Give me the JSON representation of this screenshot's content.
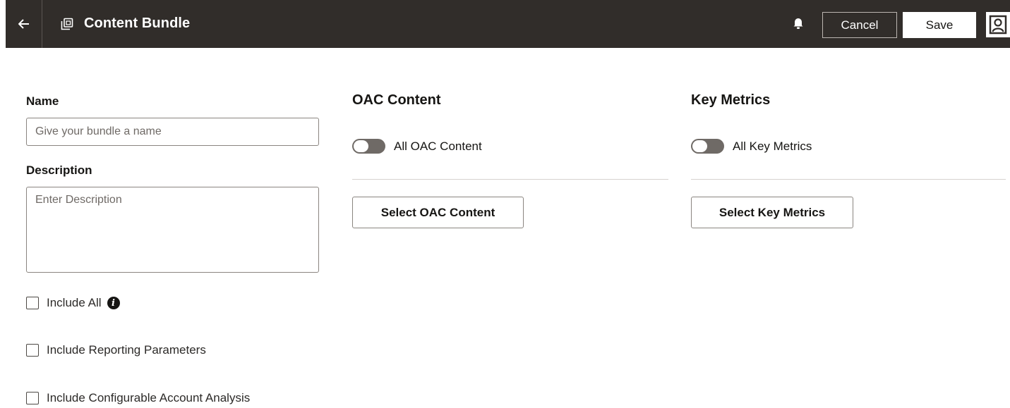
{
  "header": {
    "title": "Content Bundle",
    "cancel_label": "Cancel",
    "save_label": "Save"
  },
  "form": {
    "name_label": "Name",
    "name_placeholder": "Give your bundle a name",
    "name_value": "",
    "description_label": "Description",
    "description_placeholder": "Enter Description",
    "description_value": "",
    "checkboxes": [
      {
        "label": "Include All",
        "checked": false
      },
      {
        "label": "Include Reporting Parameters",
        "checked": false
      },
      {
        "label": "Include Configurable Account Analysis",
        "checked": false
      }
    ]
  },
  "oac": {
    "title": "OAC Content",
    "toggle_label": "All OAC Content",
    "toggle_on": false,
    "select_label": "Select OAC Content"
  },
  "metrics": {
    "title": "Key Metrics",
    "toggle_label": "All Key Metrics",
    "toggle_on": false,
    "select_label": "Select Key Metrics"
  },
  "icons": {
    "back": "arrow-left-icon",
    "bundle": "bundle-icon",
    "bell": "bell-icon",
    "avatar": "user-avatar-icon",
    "info": "info-icon"
  }
}
